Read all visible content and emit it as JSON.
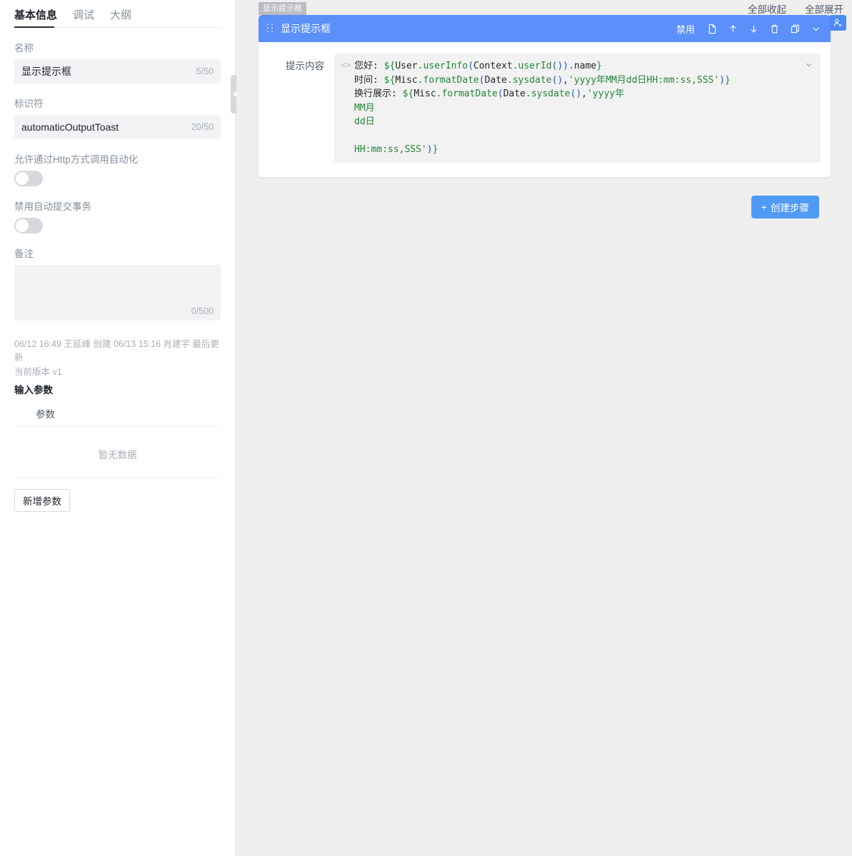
{
  "sidebar": {
    "tabs": [
      {
        "label": "基本信息",
        "active": true
      },
      {
        "label": "调试",
        "active": false
      },
      {
        "label": "大纲",
        "active": false
      }
    ],
    "fields": {
      "name_label": "名称",
      "name_value": "显示提示框",
      "name_count": "5/50",
      "ident_label": "标识符",
      "ident_value": "automaticOutputToast",
      "ident_count": "20/50",
      "http_label": "允许通过Http方式调用自动化",
      "http_on": false,
      "txn_label": "禁用自动提交事务",
      "txn_on": false,
      "remark_label": "备注",
      "remark_value": "",
      "remark_count": "0/500"
    },
    "meta": {
      "line1": "06/12 16:49 王延峰 创建 06/13 15:16 肖建宇 最后更新",
      "line2": "当前版本 v1"
    },
    "params": {
      "section_title": "输入参数",
      "column_header": "参数",
      "empty_text": "暂无数据",
      "add_button": "新增参数"
    },
    "collapse_handle_icon": "chevron-left-icon"
  },
  "main": {
    "top_actions": [
      {
        "label": "全部收起",
        "name": "collapse-all"
      },
      {
        "label": "全部展开",
        "name": "expand-all"
      }
    ],
    "drag_ghost_label": "显示提示框",
    "step": {
      "title": "显示提示框",
      "disable_label": "禁用",
      "header_icons": [
        {
          "name": "document-icon"
        },
        {
          "name": "arrow-up-icon"
        },
        {
          "name": "arrow-down-icon"
        },
        {
          "name": "trash-icon"
        },
        {
          "name": "copy-icon"
        },
        {
          "name": "chevron-down-icon"
        }
      ],
      "content_label": "提示内容",
      "gutter_icon": "code-brackets-icon",
      "code_lines": [
        [
          {
            "t": "您好: ",
            "c": "d"
          },
          {
            "t": "${",
            "c": "g"
          },
          {
            "t": "User",
            "c": "d"
          },
          {
            "t": ".",
            "c": "g"
          },
          {
            "t": "userInfo",
            "c": "g"
          },
          {
            "t": "(",
            "c": "b"
          },
          {
            "t": "Context",
            "c": "d"
          },
          {
            "t": ".",
            "c": "g"
          },
          {
            "t": "userId",
            "c": "g"
          },
          {
            "t": "()",
            "c": "b"
          },
          {
            "t": ")",
            "c": "b"
          },
          {
            "t": ".",
            "c": "g"
          },
          {
            "t": "name",
            "c": "d"
          },
          {
            "t": "}",
            "c": "g"
          }
        ],
        [
          {
            "t": "时间: ",
            "c": "d"
          },
          {
            "t": "${",
            "c": "g"
          },
          {
            "t": "Misc",
            "c": "d"
          },
          {
            "t": ".",
            "c": "g"
          },
          {
            "t": "formatDate",
            "c": "g"
          },
          {
            "t": "(",
            "c": "b"
          },
          {
            "t": "Date",
            "c": "d"
          },
          {
            "t": ".",
            "c": "g"
          },
          {
            "t": "sysdate",
            "c": "g"
          },
          {
            "t": "()",
            "c": "b"
          },
          {
            "t": ",",
            "c": "d"
          },
          {
            "t": "'yyyy年MM月dd日HH:mm:ss,SSS'",
            "c": "g"
          },
          {
            "t": ")",
            "c": "b"
          },
          {
            "t": "}",
            "c": "g"
          }
        ],
        [
          {
            "t": "换行展示: ",
            "c": "d"
          },
          {
            "t": "${",
            "c": "g"
          },
          {
            "t": "Misc",
            "c": "d"
          },
          {
            "t": ".",
            "c": "g"
          },
          {
            "t": "formatDate",
            "c": "g"
          },
          {
            "t": "(",
            "c": "b"
          },
          {
            "t": "Date",
            "c": "d"
          },
          {
            "t": ".",
            "c": "g"
          },
          {
            "t": "sysdate",
            "c": "g"
          },
          {
            "t": "()",
            "c": "b"
          },
          {
            "t": ",",
            "c": "d"
          },
          {
            "t": "'yyyy年",
            "c": "g"
          }
        ],
        [
          {
            "t": "MM月",
            "c": "g"
          }
        ],
        [
          {
            "t": "dd日",
            "c": "g"
          }
        ],
        [
          {
            "t": "",
            "c": "d"
          }
        ],
        [
          {
            "t": "HH:mm:ss,SSS'",
            "c": "g"
          },
          {
            "t": ")",
            "c": "b"
          },
          {
            "t": "}",
            "c": "g"
          }
        ]
      ],
      "collapse_icon": "chevron-down-icon"
    },
    "create_step_button": {
      "plus": "+",
      "label": "创建步骤"
    },
    "user_chip_icon": "user-add-icon"
  },
  "colors": {
    "accent_blue": "#5b8ff9",
    "button_blue": "#4e9af5",
    "code_bg": "#f2f2f2",
    "input_bg": "#f2f3f5",
    "page_bg": "#efeff0"
  }
}
